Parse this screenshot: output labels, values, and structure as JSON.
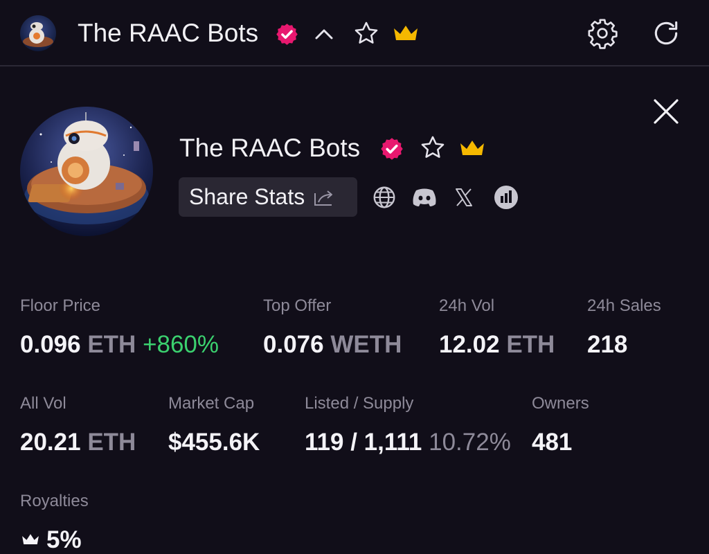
{
  "header": {
    "collection_name": "The RAAC Bots",
    "icons": [
      "verified-badge-icon",
      "chevron-up-icon",
      "star-outline-icon",
      "crown-icon",
      "gear-icon",
      "refresh-icon"
    ]
  },
  "detail": {
    "collection_name": "The RAAC Bots",
    "share_label": "Share Stats",
    "social_icons": [
      "globe-icon",
      "discord-icon",
      "x-icon",
      "chart-icon"
    ],
    "close_icon": "close-icon"
  },
  "stats": {
    "floor_price": {
      "label": "Floor Price",
      "value": "0.096",
      "unit": "ETH",
      "change": "+860%"
    },
    "top_offer": {
      "label": "Top Offer",
      "value": "0.076",
      "unit": "WETH"
    },
    "vol_24h": {
      "label": "24h Vol",
      "value": "12.02",
      "unit": "ETH"
    },
    "sales_24h": {
      "label": "24h Sales",
      "value": "218"
    },
    "all_vol": {
      "label": "All Vol",
      "value": "20.21",
      "unit": "ETH"
    },
    "market_cap": {
      "label": "Market Cap",
      "value": "$455.6K"
    },
    "listed_supply": {
      "label": "Listed / Supply",
      "value": "119 / 1,111",
      "percent": "10.72%"
    },
    "owners": {
      "label": "Owners",
      "value": "481"
    },
    "royalties": {
      "label": "Royalties",
      "value": "5%"
    }
  },
  "colors": {
    "background": "#110e19",
    "verified_pink": "#e8186f",
    "crown_gold": "#f5b800",
    "positive_green": "#3bd16f",
    "muted_text": "#8e8a99"
  }
}
